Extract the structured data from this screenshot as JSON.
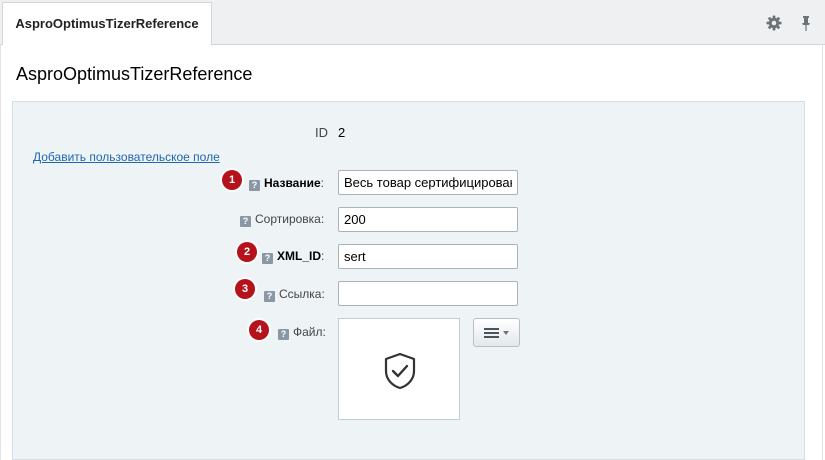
{
  "tab": {
    "label": "AsproOptimusTizerReference"
  },
  "toolbar": {
    "settings_icon": "gear-icon",
    "pin_icon": "pin-icon"
  },
  "page": {
    "title": "AsproOptimusTizerReference"
  },
  "form": {
    "id_label": "ID",
    "id_value": "2",
    "add_field_link": "Добавить пользовательское поле",
    "fields": [
      {
        "badge": "1",
        "label": "Название",
        "suffix": ":",
        "required": true,
        "value": "Весь товар сертифицирован"
      },
      {
        "badge": "",
        "label": "Сортировка",
        "suffix": ":",
        "required": false,
        "value": "200"
      },
      {
        "badge": "2",
        "label": "XML_ID",
        "suffix": ":",
        "required": true,
        "value": "sert"
      },
      {
        "badge": "3",
        "label": "Ссылка",
        "suffix": ":",
        "required": false,
        "value": ""
      },
      {
        "badge": "4",
        "label": "Файл",
        "suffix": ":",
        "required": false,
        "value": ""
      }
    ],
    "help_glyph": "?",
    "file_preview_icon": "shield-check-icon",
    "file_menu_icon": "menu-dropdown-icon"
  },
  "colors": {
    "badge": "#b5121b",
    "link": "#2067b0",
    "form_bg": "#eef3f5"
  }
}
